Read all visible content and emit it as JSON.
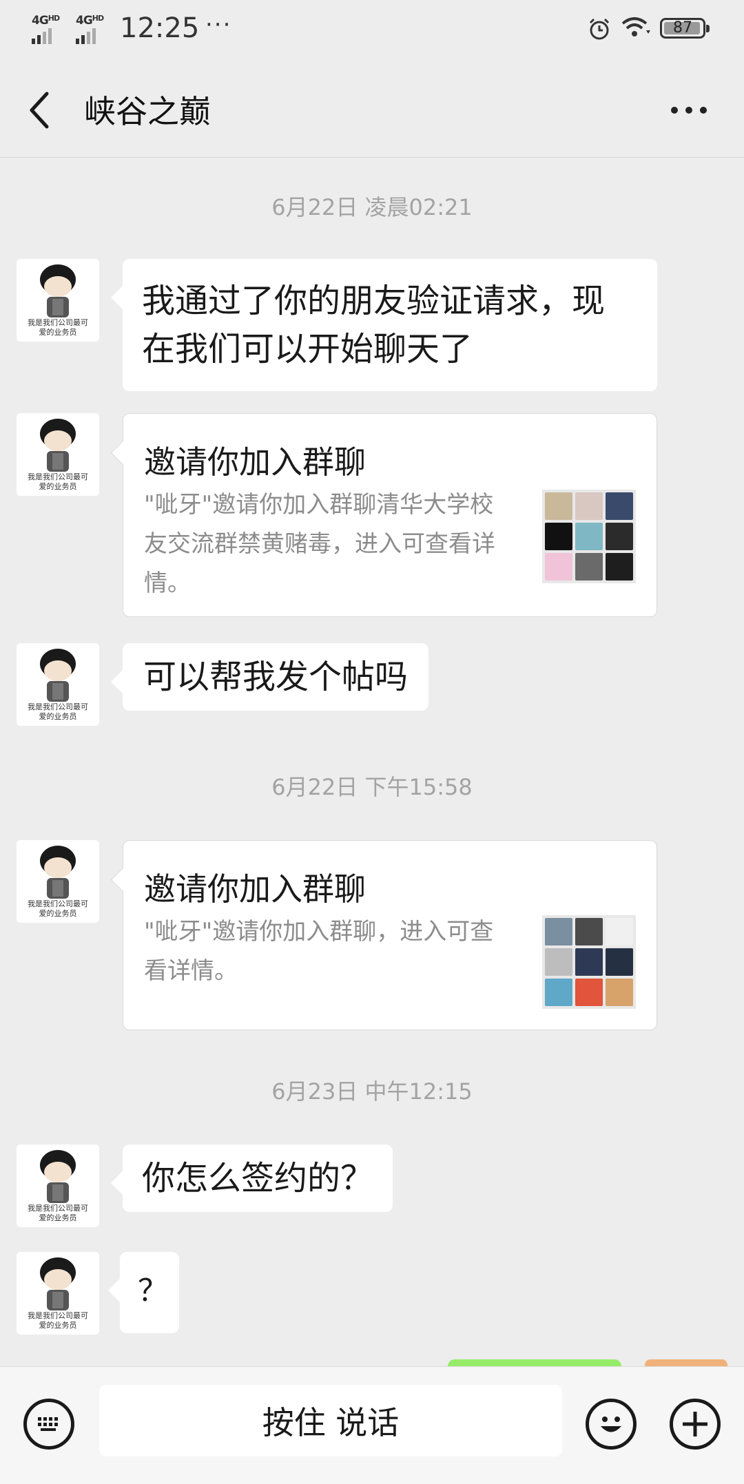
{
  "status_bar": {
    "signal1": "4G",
    "signal1_sup": "HD",
    "signal2": "4G",
    "signal2_sup": "HD",
    "time": "12:25",
    "more": "···",
    "battery": "87"
  },
  "header": {
    "title": "峡谷之巅"
  },
  "messages": [
    {
      "type": "timestamp",
      "text": "6月22日 凌晨02:21"
    },
    {
      "type": "text",
      "text": "我通过了你的朋友验证请求，现\n在我们可以开始聊天了"
    },
    {
      "type": "card",
      "title": "邀请你加入群聊",
      "desc": "\"呲牙\"邀请你加入群聊清华大学校\n友交流群禁黄赌毒，进入可查看详\n情。"
    },
    {
      "type": "text",
      "text": "可以帮我发个帖吗"
    },
    {
      "type": "timestamp",
      "text": "6月22日 下午15:58"
    },
    {
      "type": "card",
      "title": "邀请你加入群聊",
      "desc": "\"呲牙\"邀请你加入群聊，进入可查\n看详情。"
    },
    {
      "type": "timestamp",
      "text": "6月23日 中午12:15"
    },
    {
      "type": "text",
      "text": "你怎么签约的？"
    },
    {
      "type": "text",
      "text": "？"
    }
  ],
  "avatar_caption": [
    "我是我们公司最可",
    "爱的业务员"
  ],
  "bottom_bar": {
    "hold_to_talk": "按住 说话"
  },
  "colors": {
    "background": "#ededed",
    "bubble": "#ffffff",
    "timestamp": "#a3a3a3",
    "sent_bubble": "#95ec69"
  },
  "icons": [
    "back-arrow-icon",
    "more-dots-icon",
    "alarm-icon",
    "wifi-icon",
    "battery-icon",
    "keyboard-icon",
    "emoji-icon",
    "plus-icon"
  ]
}
